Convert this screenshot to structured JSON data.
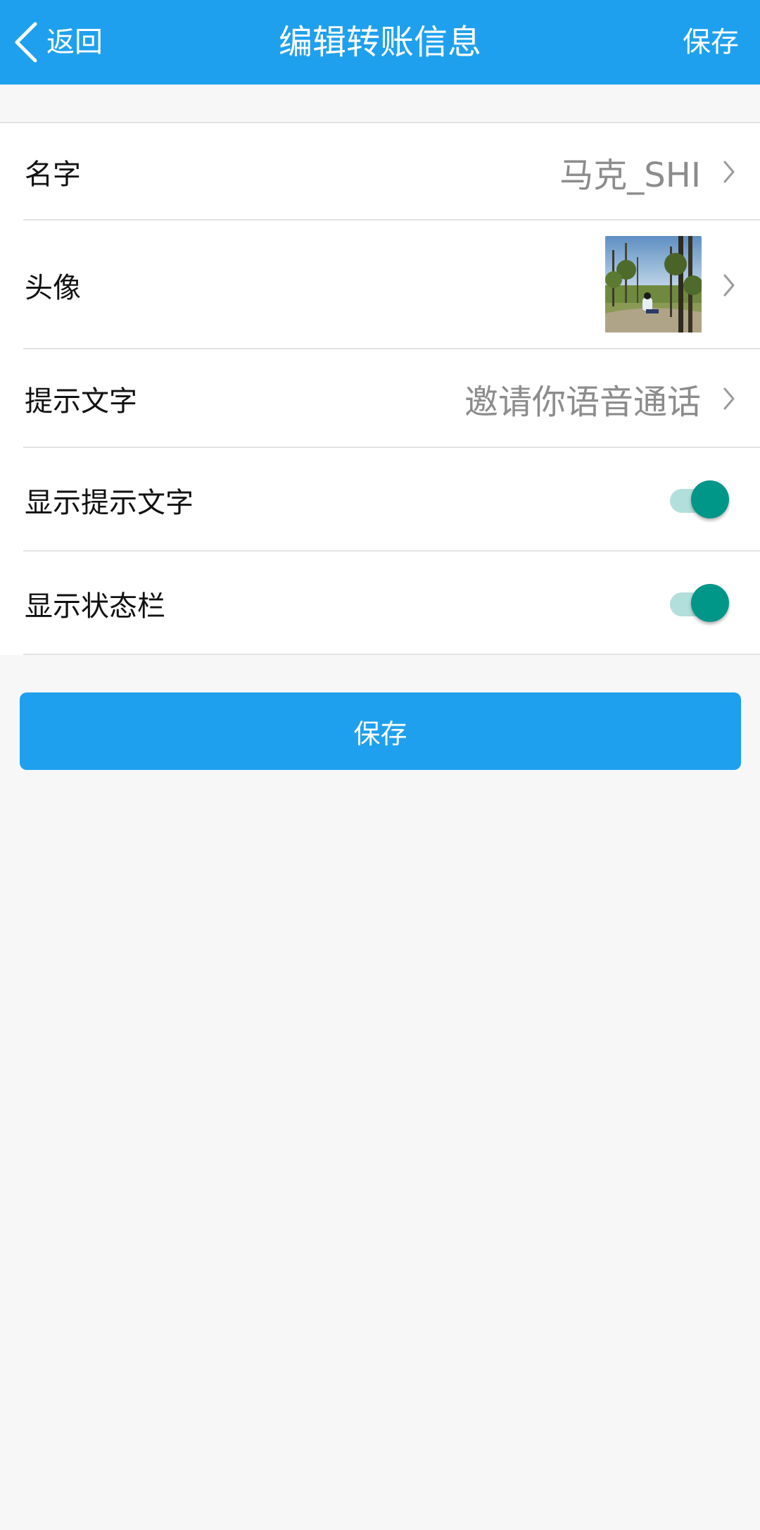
{
  "header": {
    "back_label": "返回",
    "title": "编辑转账信息",
    "save_label": "保存"
  },
  "rows": {
    "name": {
      "label": "名字",
      "value": "马克_SHI"
    },
    "avatar": {
      "label": "头像"
    },
    "hint_text": {
      "label": "提示文字",
      "value": "邀请你语音通话"
    },
    "show_hint": {
      "label": "显示提示文字",
      "on": true
    },
    "show_status_bar": {
      "label": "显示状态栏",
      "on": true
    }
  },
  "save_button": {
    "label": "保存"
  },
  "colors": {
    "primary": "#1fa0ee",
    "toggle_on": "#009688",
    "toggle_track": "#b2dfdb",
    "background": "#f7f7f7"
  },
  "icons": {
    "back": "chevron-left-icon",
    "row_arrow": "chevron-right-icon"
  }
}
